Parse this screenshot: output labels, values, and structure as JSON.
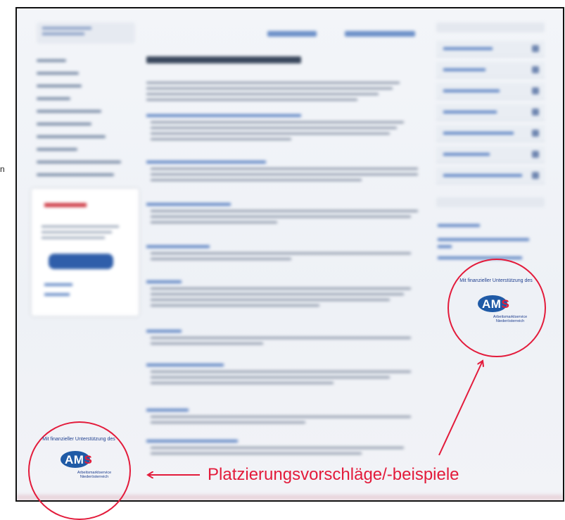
{
  "left_marker": "n",
  "logo_block_right": {
    "top": "Mit finanzieller Unterstützung des",
    "am": "AM",
    "s": "S",
    "subtitle": "Arbeitsmarktservice Niederösterreich"
  },
  "logo_block_left": {
    "top": "Mit finanzieller Unterstützung des",
    "am": "AM",
    "s": "S",
    "subtitle": "Arbeitsmarktservice Niederösterreich"
  },
  "caption": "Platzierungsvorschläge/-beispiele",
  "colors": {
    "annotation_red": "#e31b3b",
    "ams_blue": "#1f5aa6",
    "ams_text_blue": "#1f3f8f"
  }
}
